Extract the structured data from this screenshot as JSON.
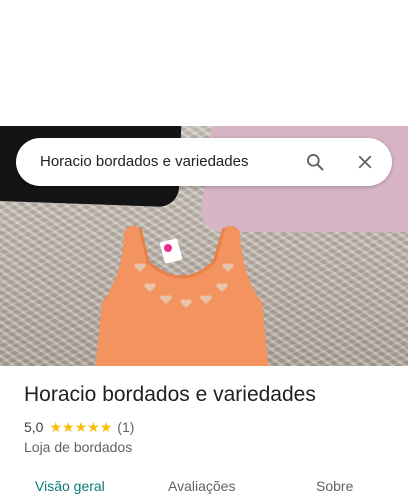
{
  "search": {
    "query": "Horacio bordados e variedades"
  },
  "place": {
    "name": "Horacio bordados e variedades",
    "rating": "5,0",
    "stars": 5,
    "review_count": "(1)",
    "category": "Loja de bordados"
  },
  "tabs": [
    {
      "label": "Visão geral"
    },
    {
      "label": "Avaliações"
    },
    {
      "label": "Sobre"
    }
  ],
  "colors": {
    "accent": "#0b7a75",
    "star": "#fbbc04",
    "shirt": "#f3935f"
  },
  "icons": {
    "search": "search-icon",
    "close": "close-icon"
  }
}
